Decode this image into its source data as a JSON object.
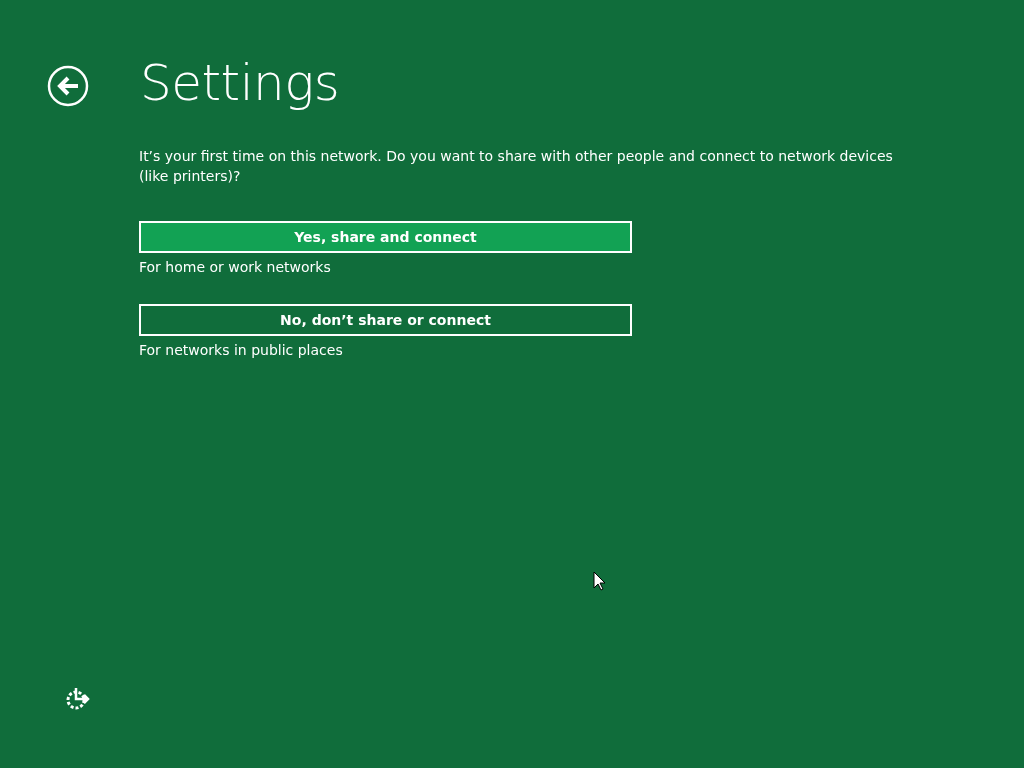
{
  "header": {
    "title": "Settings"
  },
  "prompt": "It’s your first time on this network. Do you want to share with other people and connect to network devices (like printers)?",
  "options": [
    {
      "label": "Yes, share and connect",
      "description": "For home or work networks",
      "selected": true
    },
    {
      "label": "No, don’t share or connect",
      "description": "For networks in public places",
      "selected": false
    }
  ]
}
